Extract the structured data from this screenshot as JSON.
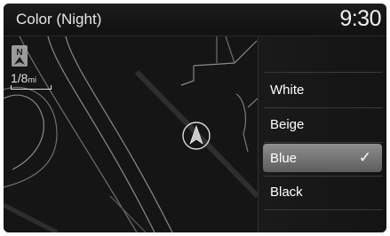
{
  "header": {
    "title": "Color (Night)",
    "clock": "9:30"
  },
  "map": {
    "scale_value": "1/8",
    "scale_unit": "mi",
    "north_label": "N"
  },
  "menu": {
    "items": [
      {
        "label": "White",
        "selected": false
      },
      {
        "label": "Beige",
        "selected": false
      },
      {
        "label": "Blue",
        "selected": true
      },
      {
        "label": "Black",
        "selected": false
      }
    ]
  },
  "icons": {
    "check": "checkmark-icon",
    "north": "north-up-icon",
    "vehicle": "vehicle-position-icon"
  }
}
